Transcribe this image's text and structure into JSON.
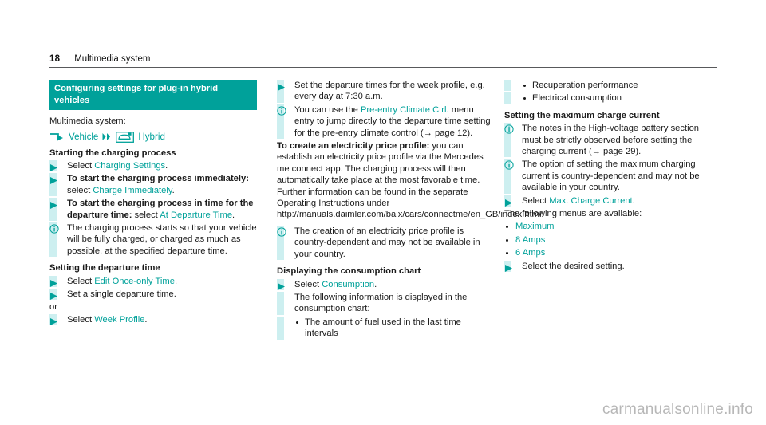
{
  "header": {
    "page_number": "18",
    "chapter": "Multimedia system"
  },
  "left_column": {
    "banner": "Configuring settings for plug-in hybrid vehicles",
    "intro": "Multimedia system:",
    "menu_path": {
      "turn_icon": "turn-arrow-icon",
      "first_label": "Vehicle",
      "chevron_icon": "double-chevron-right-icon",
      "hybrid_icon": "hybrid-car-icon",
      "second_label": "Hybrid"
    },
    "heading_start": "Starting the charging process",
    "items": [
      {
        "marker": "triangle",
        "segments": [
          {
            "text": "Select ",
            "style": "plain"
          },
          {
            "text": "Charging Settings",
            "style": "teal"
          },
          {
            "text": ".",
            "style": "plain"
          }
        ]
      },
      {
        "marker": "triangle",
        "segments": [
          {
            "text": "To start the charging process immediately:",
            "style": "bold"
          },
          {
            "text": " select ",
            "style": "plain"
          },
          {
            "text": "Charge Immediately",
            "style": "teal"
          },
          {
            "text": ".",
            "style": "plain"
          }
        ]
      },
      {
        "marker": "triangle",
        "segments": [
          {
            "text": "To start the charging process in time for the departure time:",
            "style": "bold"
          },
          {
            "text": " select ",
            "style": "plain"
          },
          {
            "text": "At Departure Time",
            "style": "teal"
          },
          {
            "text": ".",
            "style": "plain"
          }
        ]
      },
      {
        "marker": "info",
        "segments": [
          {
            "text": "The charging process starts so that your vehicle will be fully charged, or charged as much as possible, at the specified departure time.",
            "style": "plain"
          }
        ]
      }
    ],
    "heading_departure": "Setting the departure time",
    "items2": [
      {
        "marker": "triangle",
        "segments": [
          {
            "text": "Select ",
            "style": "plain"
          },
          {
            "text": "Edit Once-only Time",
            "style": "teal"
          },
          {
            "text": ".",
            "style": "plain"
          }
        ]
      },
      {
        "marker": "triangle",
        "segments": [
          {
            "text": "Set a single departure time.",
            "style": "plain"
          }
        ]
      }
    ],
    "or_label": "or",
    "items3": [
      {
        "marker": "triangle",
        "segments": [
          {
            "text": "Select ",
            "style": "plain"
          },
          {
            "text": "Week Profile",
            "style": "teal"
          },
          {
            "text": ".",
            "style": "plain"
          }
        ]
      }
    ]
  },
  "middle_column": {
    "items_top": [
      {
        "marker": "triangle",
        "segments": [
          {
            "text": "Set the departure times for the week profile, e.g. every day at 7:30 a.m.",
            "style": "plain"
          }
        ]
      },
      {
        "marker": "info",
        "segments": [
          {
            "text": "You can use the ",
            "style": "plain"
          },
          {
            "text": "Pre-entry Climate Ctrl.",
            "style": "teal"
          },
          {
            "text": " menu entry to jump directly to the departure time setting for the pre-entry climate control (→ page 12).",
            "style": "plain"
          }
        ]
      }
    ],
    "price_profile_paragraph": {
      "lead": "To create an electricity price profile:",
      "body": " you can establish an electricity price profile via the Mercedes me connect app. The charging process will then automatically take place at the most favorable time. Further information can be found in the separate Operating Instructions under http://manuals.daimler.com/baix/cars/connectme/en_GB/index.html."
    },
    "items_mid": [
      {
        "marker": "info",
        "segments": [
          {
            "text": "The creation of an electricity price profile is country-dependent and may not be available in your country.",
            "style": "plain"
          }
        ]
      }
    ],
    "heading_consumption": "Displaying the consumption chart",
    "items_bottom": [
      {
        "marker": "triangle",
        "segments": [
          {
            "text": "Select ",
            "style": "plain"
          },
          {
            "text": "Consumption",
            "style": "teal"
          },
          {
            "text": ".",
            "style": "plain"
          }
        ]
      }
    ],
    "consumption_note": "The following information is displayed in the consumption chart:",
    "consumption_bullets": [
      "The amount of fuel used in the last time intervals"
    ]
  },
  "right_column": {
    "bullets_top": [
      "Recuperation performance",
      "Electrical consumption"
    ],
    "heading_max_current": "Setting the maximum charge current",
    "items_top": [
      {
        "marker": "info",
        "segments": [
          {
            "text": "The notes in the High-voltage battery section must be strictly observed before setting the charging current (→ page 29).",
            "style": "plain"
          }
        ]
      },
      {
        "marker": "info",
        "segments": [
          {
            "text": "The option of setting the maximum charging current is country-dependent and may not be available in your country.",
            "style": "plain"
          }
        ]
      },
      {
        "marker": "triangle",
        "segments": [
          {
            "text": "Select ",
            "style": "plain"
          },
          {
            "text": "Max. Charge Current",
            "style": "teal"
          },
          {
            "text": ".",
            "style": "plain"
          }
        ]
      }
    ],
    "menus_intro": "The following menus are available:",
    "menu_options": [
      "Maximum",
      "8 Amps",
      "6 Amps"
    ],
    "items_bottom": [
      {
        "marker": "triangle",
        "segments": [
          {
            "text": "Select the desired setting.",
            "style": "plain"
          }
        ]
      }
    ]
  },
  "watermark": "carmanualsonline.info",
  "colors": {
    "teal": "#00a19a",
    "cyan_bar": "#cdeff0",
    "rule": "#58595b",
    "watermark": "#b7b7b7"
  }
}
